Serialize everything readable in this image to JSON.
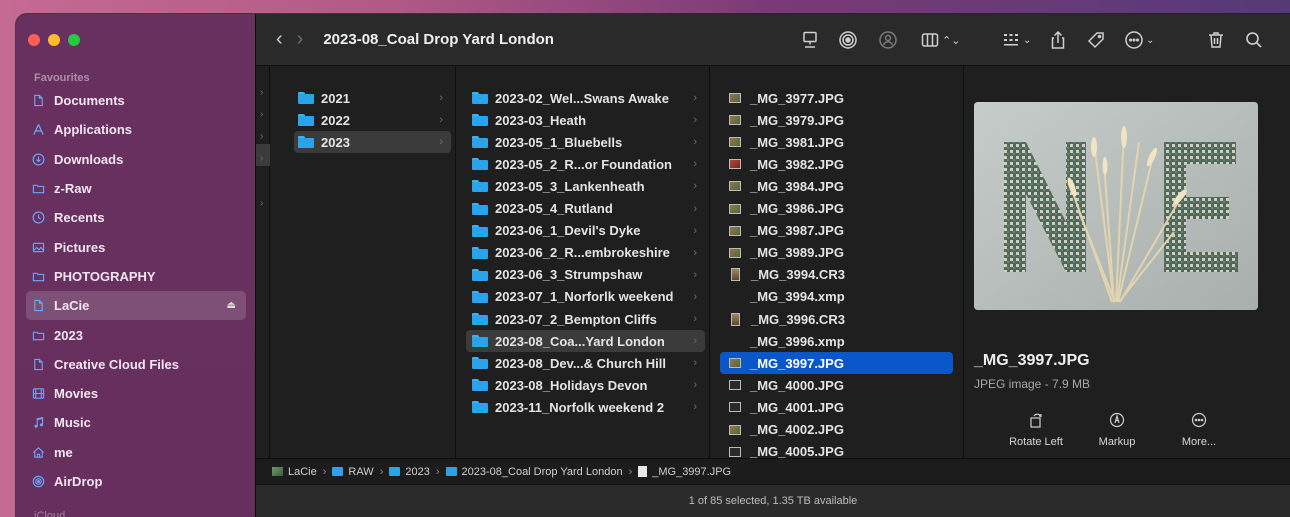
{
  "toolbar": {
    "back": "‹",
    "forward": "›",
    "title": "2023-08_Coal Drop Yard London"
  },
  "sidebar": {
    "section": "Favourites",
    "items": [
      {
        "label": "Documents",
        "icon": "document-icon"
      },
      {
        "label": "Applications",
        "icon": "applications-icon"
      },
      {
        "label": "Downloads",
        "icon": "download-icon"
      },
      {
        "label": "z-Raw",
        "icon": "folder-icon"
      },
      {
        "label": "Recents",
        "icon": "clock-icon"
      },
      {
        "label": "Pictures",
        "icon": "pictures-icon"
      },
      {
        "label": "PHOTOGRAPHY",
        "icon": "folder-icon"
      },
      {
        "label": "LaCie",
        "icon": "document-icon",
        "eject": "⏏"
      },
      {
        "label": "2023",
        "icon": "folder-icon"
      },
      {
        "label": "Creative Cloud Files",
        "icon": "document-icon"
      },
      {
        "label": "Movies",
        "icon": "movies-icon"
      },
      {
        "label": "Music",
        "icon": "music-icon"
      },
      {
        "label": "me",
        "icon": "home-icon"
      },
      {
        "label": "AirDrop",
        "icon": "airdrop-icon"
      }
    ],
    "next_section_partial": "iCloud"
  },
  "columns": {
    "years": [
      "2021",
      "2022",
      "2023"
    ],
    "folders": [
      "2023-02_Wel...Swans Awake",
      "2023-03_Heath",
      "2023-05_1_Bluebells",
      "2023-05_2_R...or Foundation",
      "2023-05_3_Lankenheath",
      "2023-05_4_Rutland",
      "2023-06_1_Devil's Dyke",
      "2023-06_2_R...embrokeshire",
      "2023-06_3_Strumpshaw",
      "2023-07_1_Norforlk weekend",
      "2023-07_2_Bempton Cliffs",
      "2023-08_Coa...Yard London",
      "2023-08_Dev...& Church Hill",
      "2023-08_Holidays Devon",
      "2023-11_Norfolk weekend 2"
    ],
    "files": [
      "_MG_3977.JPG",
      "_MG_3979.JPG",
      "_MG_3981.JPG",
      "_MG_3982.JPG",
      "_MG_3984.JPG",
      "_MG_3986.JPG",
      "_MG_3987.JPG",
      "_MG_3989.JPG",
      "_MG_3994.CR3",
      "_MG_3994.xmp",
      "_MG_3996.CR3",
      "_MG_3996.xmp",
      "_MG_3997.JPG",
      "_MG_4000.JPG",
      "_MG_4001.JPG",
      "_MG_4002.JPG",
      "_MG_4005.JPG"
    ]
  },
  "preview": {
    "name": "_MG_3997.JPG",
    "kind": "JPEG image - 7.9 MB",
    "actions": [
      "Rotate Left",
      "Markup",
      "More..."
    ]
  },
  "pathbar": [
    "LaCie",
    "RAW",
    "2023",
    "2023-08_Coal Drop Yard London",
    "_MG_3997.JPG"
  ],
  "status": "1 of 85 selected, 1.35 TB available",
  "colors": {
    "selection_blue": "#0a57c9",
    "folder_blue": "#29a3ea",
    "sidebar_tint": "#6e3264"
  }
}
